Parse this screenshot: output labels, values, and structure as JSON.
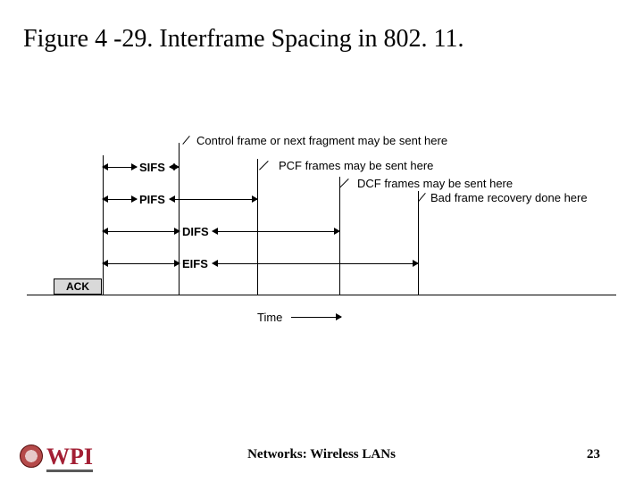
{
  "title": "Figure 4 -29. Interframe Spacing in 802. 11.",
  "spacings": {
    "sifs": "SIFS",
    "pifs": "PIFS",
    "difs": "DIFS",
    "eifs": "EIFS"
  },
  "annotations": {
    "control": "Control frame or next fragment may be sent here",
    "pcf": "PCF frames may be sent here",
    "dcf": "DCF frames may be sent here",
    "badframe": "Bad frame recovery done here"
  },
  "ack": "ACK",
  "time_label": "Time",
  "footer": "Networks: Wireless LANs",
  "page": "23",
  "logo_text": "WPI"
}
